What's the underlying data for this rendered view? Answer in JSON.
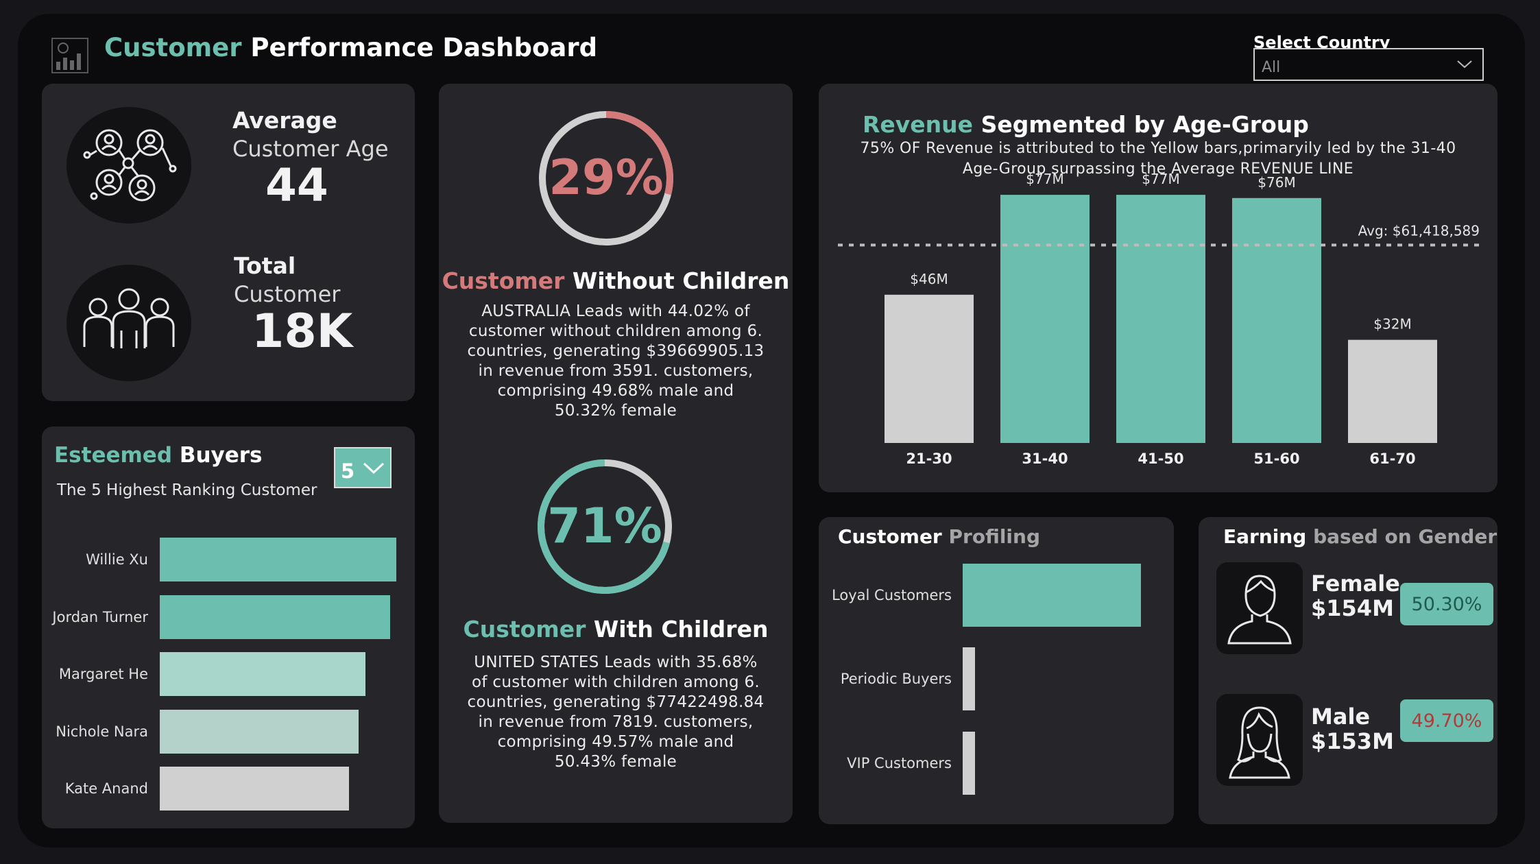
{
  "header": {
    "title_accent": "Customer",
    "title_rest": "Performance Dashboard",
    "country_label": "Select Country",
    "country_value": "All"
  },
  "kpis": {
    "avg_age_title": "Average",
    "avg_age_sub": "Customer Age",
    "avg_age_value": "44",
    "total_title": "Total",
    "total_sub": "Customer",
    "total_value": "18K"
  },
  "esteemed": {
    "title_accent": "Esteemed",
    "title_rest": "Buyers",
    "subtitle": "The 5 Highest Ranking Customer",
    "top_n": "5",
    "customers": [
      {
        "name": "Willie Xu",
        "value": 100,
        "color": "#6cbfae"
      },
      {
        "name": "Jordan Turner",
        "value": 97.5,
        "color": "#6cbfae"
      },
      {
        "name": "Margaret He",
        "value": 87,
        "color": "#a9d6cb"
      },
      {
        "name": "Nichole Nara",
        "value": 84,
        "color": "#b4d2ca"
      },
      {
        "name": "Kate Anand",
        "value": 80,
        "color": "#d0d0d0"
      }
    ]
  },
  "without_children": {
    "percent": "29%",
    "percent_value": 29,
    "title_accent": "Customer",
    "title_rest": "Without Children",
    "description": "AUSTRALIA Leads with 44.02% of customer without children among 6. countries, generating $39669905.13 in revenue from 3591. customers, comprising 49.68% male and 50.32% female"
  },
  "with_children": {
    "percent": "71%",
    "percent_value": 71,
    "title_accent": "Customer",
    "title_rest": "With Children",
    "description": "UNITED STATES Leads with 35.68% of customer with children among 6. countries, generating $77422498.84 in revenue from 7819. customers, comprising 49.57% male and 50.43% female"
  },
  "revenue_chart": {
    "title_accent": "Revenue",
    "title_rest": "Segmented by Age-Group",
    "subtitle_line1": "75% OF Revenue is attributed to the Yellow bars,primaryily led by the 31-40",
    "subtitle_line2": "Age-Group surpassing the Average REVENUE LINE",
    "avg_label": "Avg: $61,418,589"
  },
  "chart_data": {
    "type": "bar",
    "categories": [
      "21-30",
      "31-40",
      "41-50",
      "51-60",
      "61-70"
    ],
    "values": [
      46,
      77,
      77,
      76,
      32
    ],
    "data_labels": [
      "$46M",
      "$77M",
      "$77M",
      "$76M",
      "$32M"
    ],
    "colors": [
      "#d0d0d0",
      "#6cbfae",
      "#6cbfae",
      "#6cbfae",
      "#d0d0d0"
    ],
    "average": 61.418589,
    "ylim": [
      0,
      80
    ],
    "units": "$M",
    "grid": false
  },
  "profiling": {
    "title_main": "Customer",
    "title_sub": "Profiling",
    "segments": [
      {
        "name": "Loyal Customers",
        "value": 100,
        "color": "#6cbfae"
      },
      {
        "name": "Periodic Buyers",
        "value": 7,
        "color": "#d0d0d0"
      },
      {
        "name": "VIP Customers",
        "value": 5,
        "color": "#d0d0d0"
      }
    ]
  },
  "gender": {
    "title_main": "Earning",
    "title_sub": "based on Gender",
    "female_label": "Female",
    "female_value": "$154M",
    "female_pct": "50.30%",
    "male_label": "Male",
    "male_value": "$153M",
    "male_pct": "49.70%"
  },
  "icons": [
    "dashboard-logo-icon",
    "network-people-icon",
    "group-people-icon",
    "chevron-down-icon",
    "male-avatar-icon",
    "female-avatar-icon"
  ]
}
